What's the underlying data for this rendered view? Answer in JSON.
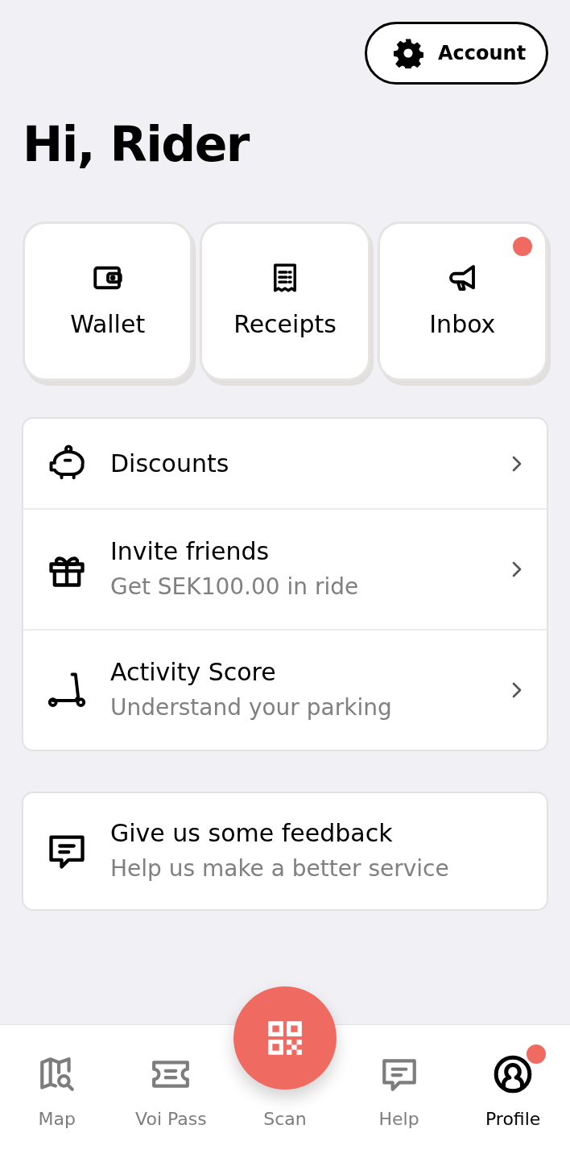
{
  "account_button": {
    "label": "Account"
  },
  "greeting": "Hi, Rider",
  "tiles": [
    {
      "kind": "wallet",
      "label": "Wallet",
      "badge": false
    },
    {
      "kind": "receipts",
      "label": "Receipts",
      "badge": false
    },
    {
      "kind": "inbox",
      "label": "Inbox",
      "badge": true
    }
  ],
  "menu": [
    {
      "kind": "discounts",
      "title": "Discounts"
    },
    {
      "kind": "invite",
      "title": "Invite friends",
      "subtitle": "Get SEK100.00 in ride"
    },
    {
      "kind": "activity",
      "title": "Activity Score",
      "subtitle": "Understand your parking"
    }
  ],
  "feedback": {
    "title": "Give us some feedback",
    "subtitle": "Help us make a better service"
  },
  "nav": [
    {
      "kind": "map",
      "label": "Map",
      "selected": false,
      "badge": false
    },
    {
      "kind": "pass",
      "label": "Voi Pass",
      "selected": false,
      "badge": false
    },
    {
      "kind": "scan",
      "label": "Scan",
      "selected": false
    },
    {
      "kind": "help",
      "label": "Help",
      "selected": false,
      "badge": false
    },
    {
      "kind": "profile",
      "label": "Profile",
      "selected": true,
      "badge": true
    }
  ]
}
